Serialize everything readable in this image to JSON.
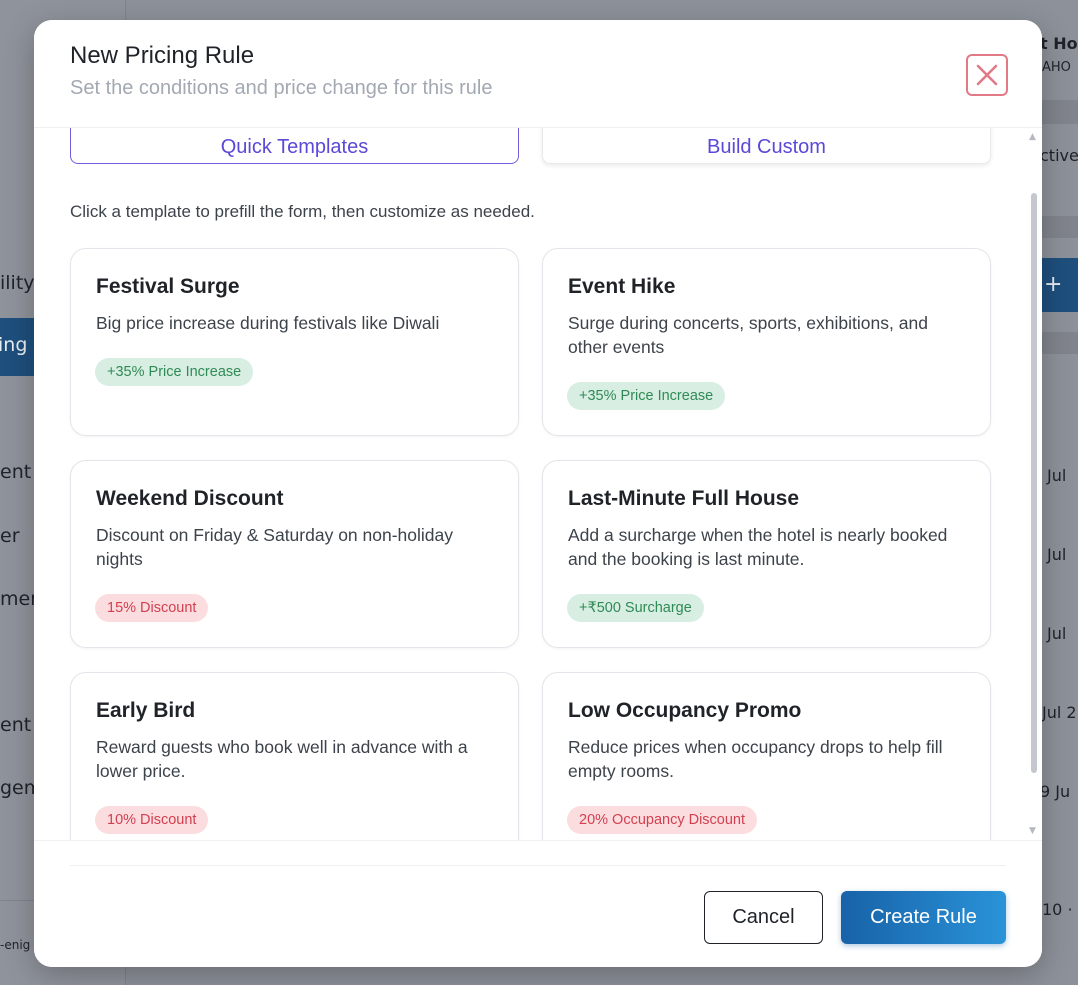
{
  "background": {
    "sidebar_items": [
      "ility",
      "ent",
      "er",
      "men",
      "ent",
      "gem"
    ],
    "sidebar_active": "ing",
    "sidebar_footer": "-enig",
    "right_texts": [
      "t Ho",
      "AHO",
      "ctive",
      "Jul",
      "Jul",
      "Jul",
      "Jul 2",
      "9 Ju",
      "10 ·"
    ],
    "right_plus": "+"
  },
  "modal": {
    "title": "New Pricing Rule",
    "subtitle": "Set the conditions and price change for this rule",
    "tabs": {
      "quick": "Quick Templates",
      "custom": "Build Custom"
    },
    "helper": "Click a template to prefill the form, then customize as needed.",
    "templates": [
      {
        "title": "Festival Surge",
        "desc": "Big price increase during festivals like Diwali",
        "badge": "+35% Price Increase",
        "badge_kind": "green"
      },
      {
        "title": "Event Hike",
        "desc": "Surge during concerts, sports, exhibitions, and other events",
        "badge": "+35% Price Increase",
        "badge_kind": "green"
      },
      {
        "title": "Weekend Discount",
        "desc": "Discount on Friday & Saturday on non-holiday nights",
        "badge": "15% Discount",
        "badge_kind": "red"
      },
      {
        "title": "Last-Minute Full House",
        "desc": "Add a surcharge when the hotel is nearly booked and the booking is last minute.",
        "badge": "+₹500 Surcharge",
        "badge_kind": "green"
      },
      {
        "title": "Early Bird",
        "desc": "Reward guests who book well in advance with a lower price.",
        "badge": "10% Discount",
        "badge_kind": "red"
      },
      {
        "title": "Low Occupancy Promo",
        "desc": "Reduce prices when occupancy drops to help fill empty rooms.",
        "badge": "20% Occupancy Discount",
        "badge_kind": "red"
      }
    ],
    "footer": {
      "cancel": "Cancel",
      "create": "Create Rule"
    }
  },
  "colors": {
    "accent": "#5a49d8",
    "primary_button": "#1862a8",
    "close_border": "#e27a86",
    "badge_green_bg": "#d8eee3",
    "badge_green_text": "#2f8a55",
    "badge_red_bg": "#fbdde0",
    "badge_red_text": "#d2404f"
  }
}
